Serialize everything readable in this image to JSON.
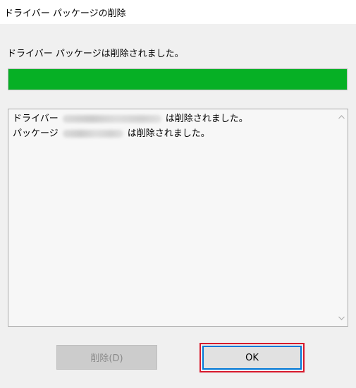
{
  "window": {
    "title": "ドライバー パッケージの削除"
  },
  "status": {
    "message": "ドライバー パッケージは削除されました。",
    "progress_percent": 100,
    "progress_color": "#06b025"
  },
  "log": {
    "lines": [
      {
        "prefix": "ドライバー",
        "suffix": "は削除されました。"
      },
      {
        "prefix": "パッケージ",
        "suffix": "は削除されました。"
      }
    ]
  },
  "buttons": {
    "delete_label": "削除(D)",
    "delete_enabled": false,
    "ok_label": "OK",
    "ok_highlight_color": "#d7192c"
  },
  "icons": {
    "scroll_up": "chevron-up-icon",
    "scroll_down": "chevron-down-icon"
  }
}
